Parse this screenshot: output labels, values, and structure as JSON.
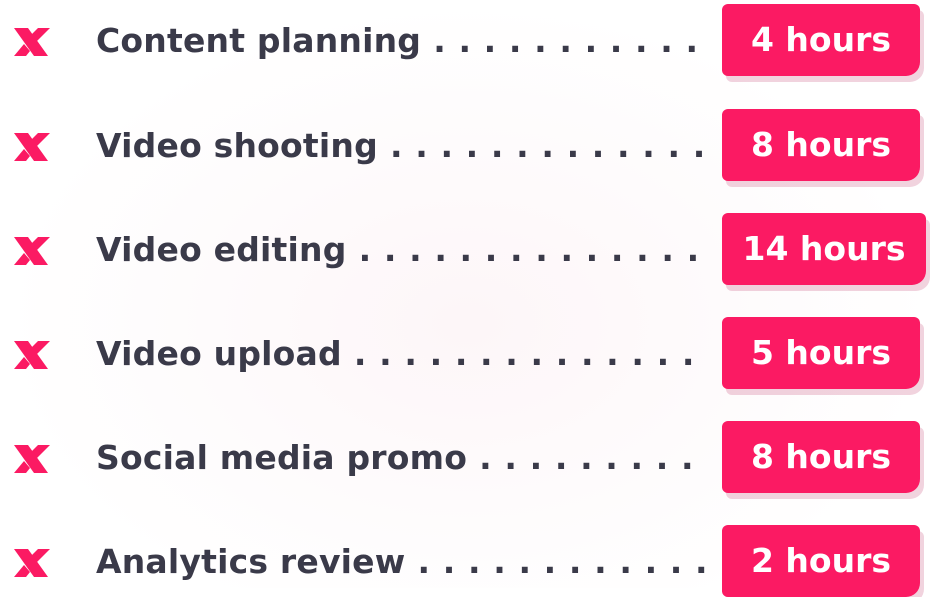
{
  "colors": {
    "accent": "#fb1a63",
    "text": "#3a3a49",
    "badge_text": "#ffffff"
  },
  "items": [
    {
      "icon": "x-mark-icon",
      "label": "Content planning",
      "duration": "4 hours"
    },
    {
      "icon": "x-mark-icon",
      "label": "Video shooting",
      "duration": "8 hours"
    },
    {
      "icon": "x-mark-icon",
      "label": "Video editing",
      "duration": "14 hours"
    },
    {
      "icon": "x-mark-icon",
      "label": "Video upload",
      "duration": "5 hours"
    },
    {
      "icon": "x-mark-icon",
      "label": "Social media promo",
      "duration": "8 hours"
    },
    {
      "icon": "x-mark-icon",
      "label": "Analytics review",
      "duration": "2 hours"
    }
  ]
}
